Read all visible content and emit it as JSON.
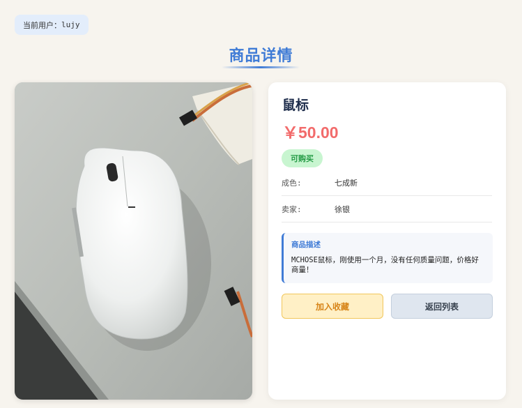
{
  "user_badge": {
    "prefix": "当前用户：",
    "username": "lujy"
  },
  "page": {
    "title": "商品详情"
  },
  "product": {
    "name": "鼠标",
    "price": "￥50.00",
    "status": "可购买",
    "condition_label": "成色:",
    "condition_value": "七成新",
    "seller_label": "卖家:",
    "seller_value": "徐银",
    "description_title": "商品描述",
    "description_text": "MCHOSE鼠标，刚使用一个月，没有任何质量问题，价格好商量！",
    "image_alt": "white wireless mouse on desk"
  },
  "actions": {
    "favorite_label": "加入收藏",
    "back_label": "返回列表"
  },
  "colors": {
    "accent": "#3f7bd6",
    "price": "#f26b6b",
    "status_bg": "#c8f5d0",
    "status_text": "#239a44"
  }
}
